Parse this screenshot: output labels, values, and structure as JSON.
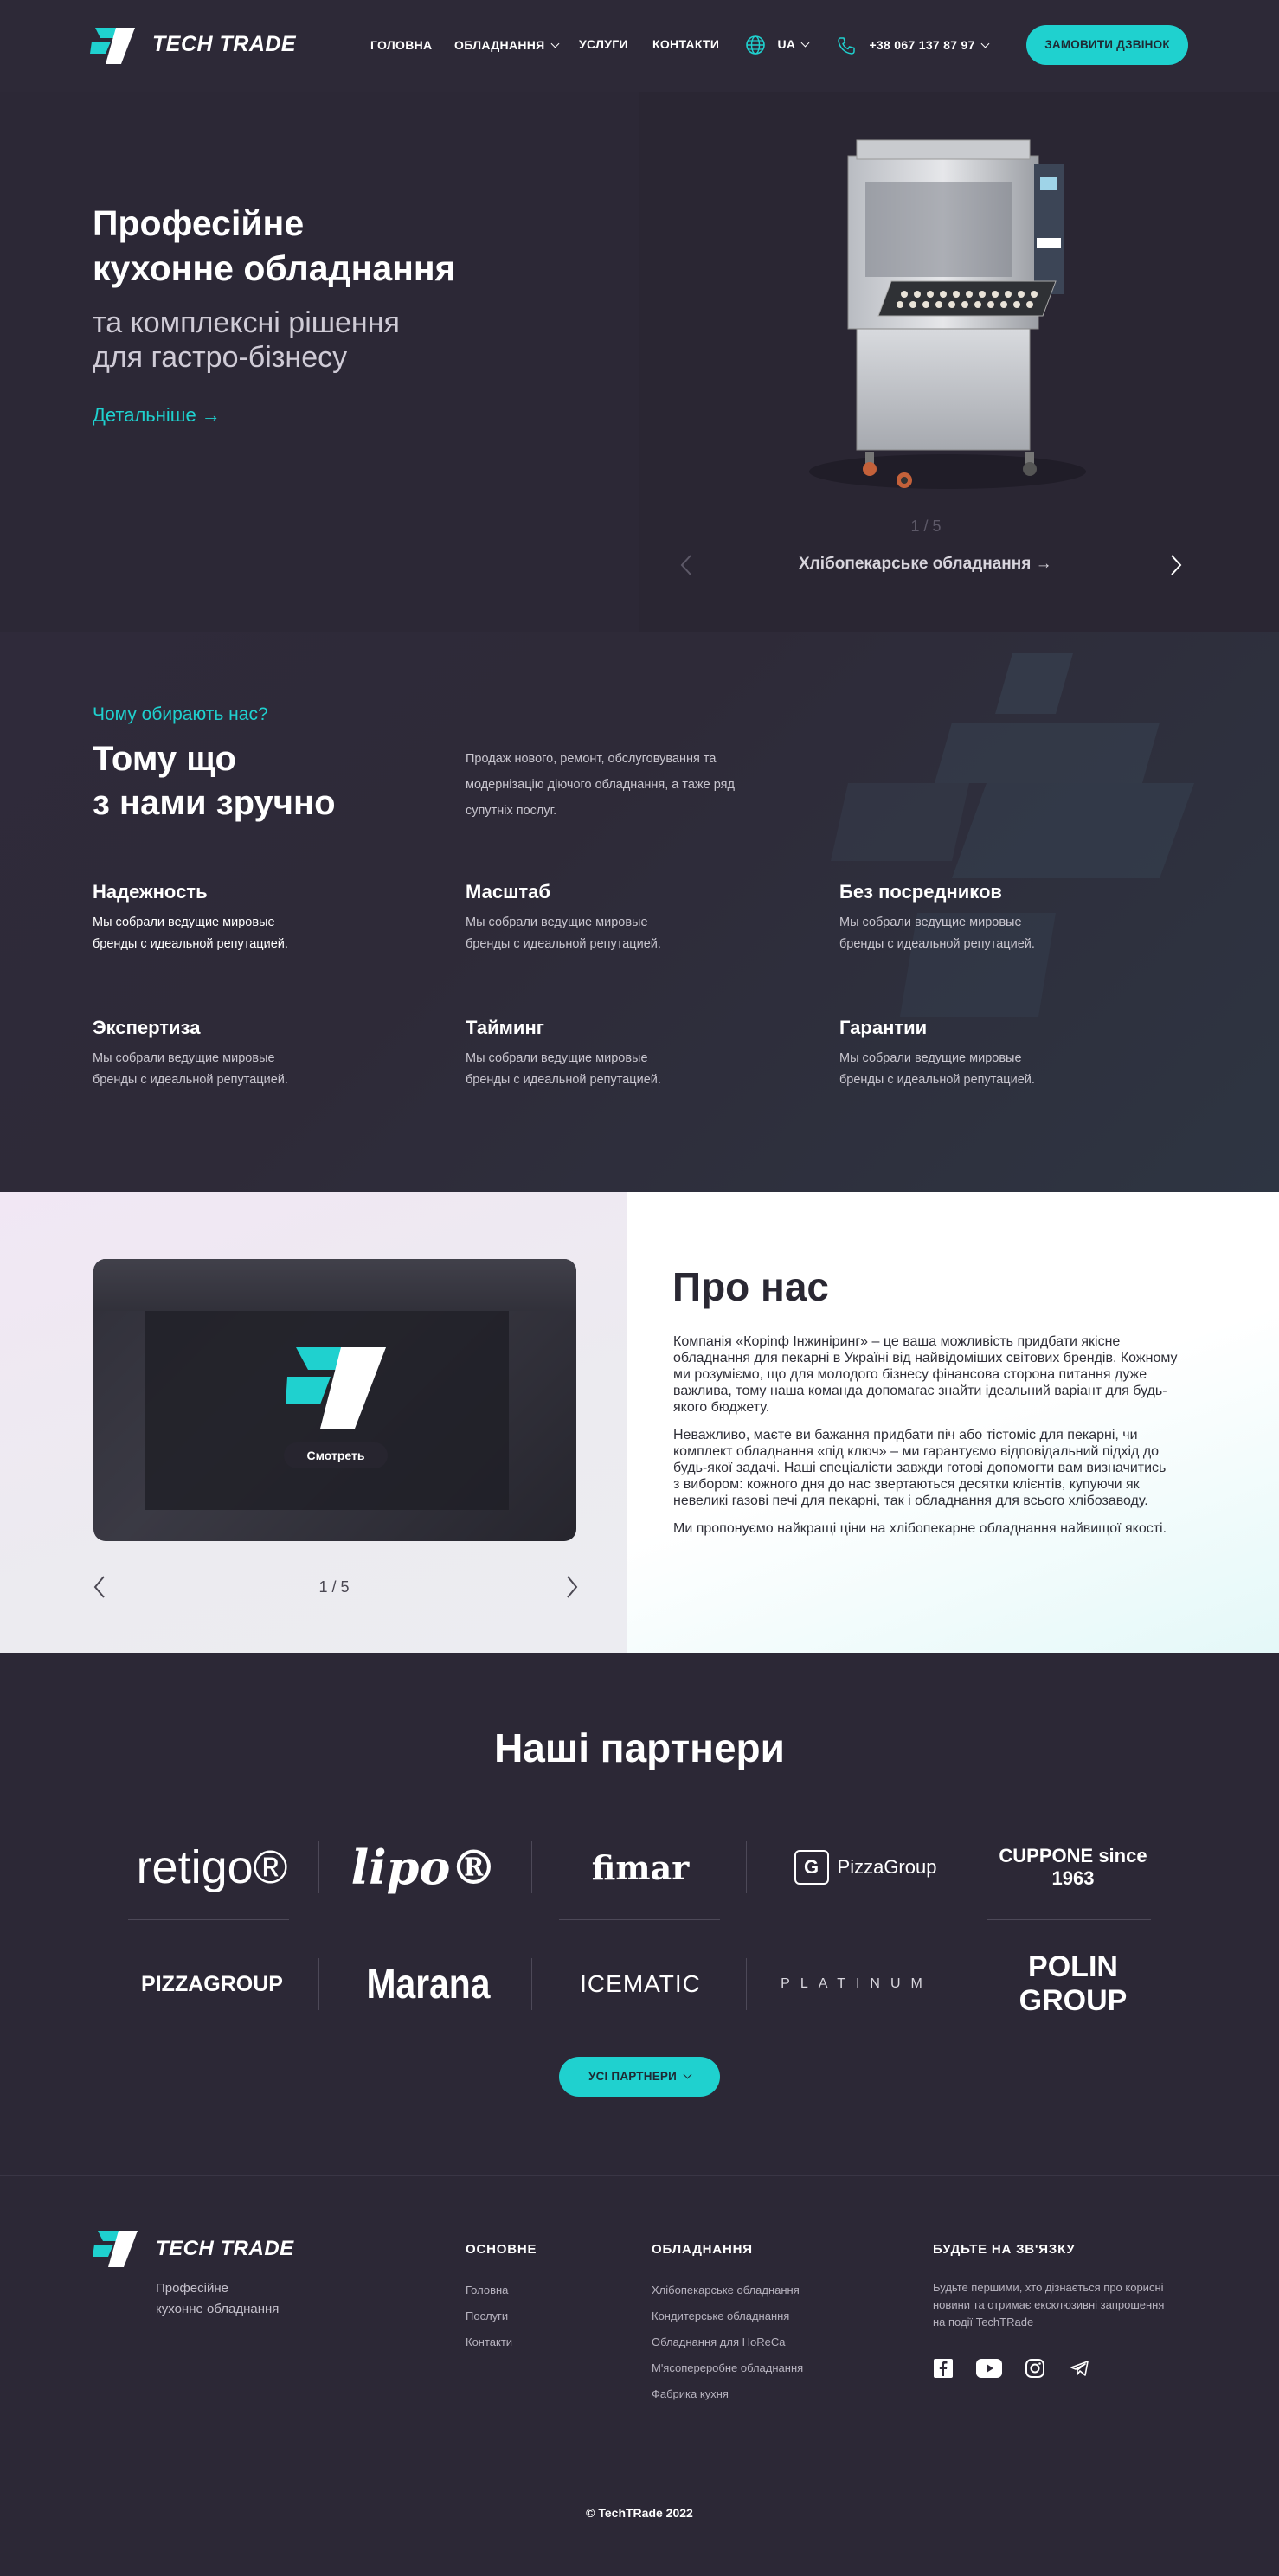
{
  "header": {
    "logo_text": "TECH TRADE",
    "nav": [
      "ГОЛОВНА",
      "ОБЛАДНАННЯ",
      "УСЛУГИ",
      "КОНТАКТИ"
    ],
    "lang": "UA",
    "phone": "+38 067 137 87 97",
    "cta": "ЗАМОВИТИ ДЗВІНОК"
  },
  "hero": {
    "title_line1": "Професійне",
    "title_line2": "кухонне обладнання",
    "subtitle_line1": "та комплексні рішення",
    "subtitle_line2": "для гастро-бізнесу",
    "link": "Детальніше →",
    "slide_counter": "1 / 5",
    "slide_caption": "Хлібопекарське обладнання →"
  },
  "why": {
    "kicker": "Чому обирають нас?",
    "title_line1": "Тому що",
    "title_line2": "з нами зручно",
    "intro_line1": "Продаж нового, ремонт, обслуговування та",
    "intro_line2": "модернізацію діючого обладнання,  а таже ряд",
    "intro_line3": "супутніх послуг.",
    "features": [
      {
        "title": "Надежность",
        "l1": "Мы собрали ведущие мировые",
        "l2": "бренды с идеальной репутацией."
      },
      {
        "title": "Масштаб",
        "l1": "Мы собрали ведущие мировые",
        "l2": "бренды с идеальной репутацией."
      },
      {
        "title": "Без посредников",
        "l1": "Мы собрали ведущие мировые",
        "l2": "бренды с идеальной репутацией."
      },
      {
        "title": "Экспертиза",
        "l1": "Мы собрали ведущие мировые",
        "l2": "бренды с идеальной репутацией."
      },
      {
        "title": "Тайминг",
        "l1": "Мы собрали ведущие мировые",
        "l2": "бренды с идеальной репутацией."
      },
      {
        "title": "Гарантии",
        "l1": "Мы собрали ведущие мировые",
        "l2": "бренды с идеальной репутацией."
      }
    ]
  },
  "about": {
    "watch": "Смотреть",
    "counter": "1 / 5",
    "title": "Про нас",
    "p1": [
      "Компанія «Коріnф Інжиніринг» – це ваша можливість придбати якісне",
      "обладнання для пекарні в Україні від найвідоміших світових брендів. Кожному",
      "ми розуміємо, що для молодого бізнесу фінансова сторона питання дуже",
      "важлива, тому наша команда допомагає знайти ідеальний варіант для будь-",
      "якого бюджету."
    ],
    "p2": [
      "Неважливо, маєте ви бажання придбати піч або тістоміс для пекарні, чи",
      "комплект обладнання «під ключ» – ми гарантуємо відповідальний підхід до",
      "будь-якої задачі. Наші спеціалісти завжди готові допомогти вам визначитись",
      "з вибором: кожного дня до нас звертаються десятки клієнтів, купуючи як",
      "невеликі газові печі для пекарні, так і обладнання для всього хлібозаводу."
    ],
    "p3": "Ми пропонуємо найкращі ціни на хлібопекарне обладнання найвищої якості."
  },
  "partners": {
    "title": "Наші партнери",
    "row1": [
      "retigo®",
      "lipo®",
      "fimar",
      "PizzaGroup",
      "CUPPONE since 1963"
    ],
    "row2": [
      "PIZZAGROUP",
      "Marana",
      "ICEMATIC",
      "PLATINUM",
      "POLIN GROUP"
    ],
    "button": "УСІ ПАРТНЕРИ"
  },
  "footer": {
    "logo_text": "TECH TRADE",
    "tag1": "Професійне",
    "tag2": "кухонне обладнання",
    "col1_title": "ОСНОВНЕ",
    "col1": [
      "Головна",
      "Послуги",
      "Контакти"
    ],
    "col2_title": "ОБЛАДНАННЯ",
    "col2": [
      "Хлібопекарське обладнання",
      "Кондитерське обладнання",
      "Обладнання для HoReCa",
      "М'ясопереробне обладнання",
      "Фабрика кухня"
    ],
    "col3_title": "БУДЬТЕ НА ЗВ'ЯЗКУ",
    "col3_text": [
      "Будьте першими, хто дізнається про корисні",
      "новини та отримає ексклюзивні запрошення",
      "на події TechTRade"
    ],
    "copyright": "© TechTRade 2022"
  },
  "colors": {
    "accent": "#1fd1cf",
    "bg_dark": "#2c2836"
  }
}
